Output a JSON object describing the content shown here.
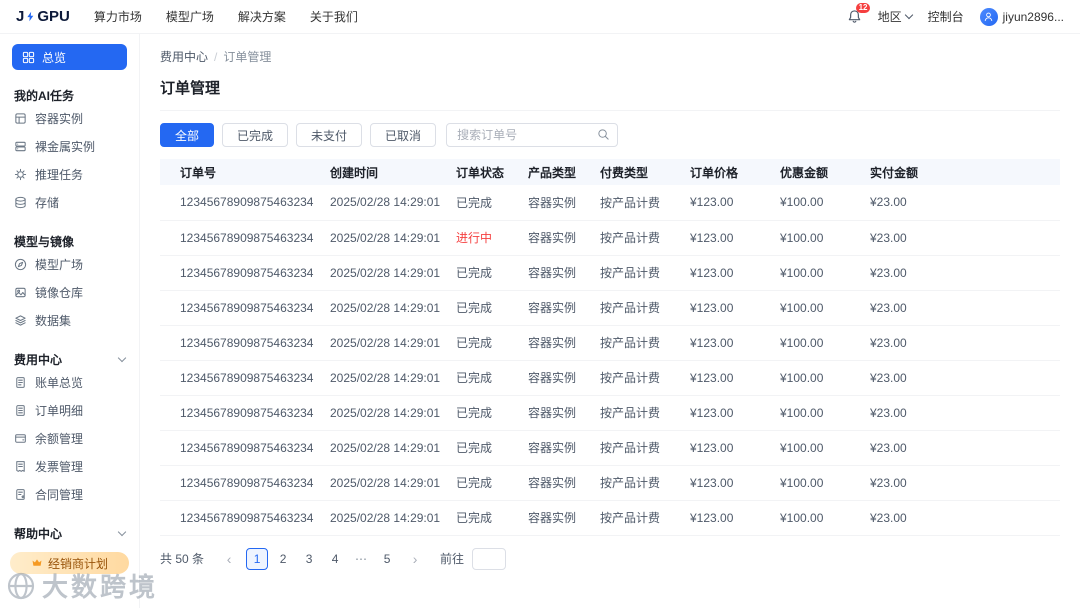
{
  "colors": {
    "primary": "#2468f2",
    "status_running": "#f53f3f",
    "status_done": "#4e5969",
    "badge_red": "#f53f3f",
    "dealer_text": "#99540a"
  },
  "navbar": {
    "logo_left": "J",
    "logo_right": "GPU",
    "items": [
      {
        "label": "算力市场"
      },
      {
        "label": "模型广场"
      },
      {
        "label": "解决方案"
      },
      {
        "label": "关于我们"
      }
    ],
    "notification_count": "12",
    "region_label": "地区",
    "console_label": "控制台",
    "username": "jiyun2896..."
  },
  "sidebar": {
    "overview_label": "总览",
    "sections": [
      {
        "title": "我的AI任务",
        "collapsible": false,
        "items": [
          {
            "label": "容器实例",
            "icon": "container-icon"
          },
          {
            "label": "裸金属实例",
            "icon": "baremetal-icon"
          },
          {
            "label": "推理任务",
            "icon": "inference-icon"
          },
          {
            "label": "存储",
            "icon": "storage-icon"
          }
        ]
      },
      {
        "title": "模型与镜像",
        "collapsible": false,
        "items": [
          {
            "label": "模型广场",
            "icon": "model-market-icon"
          },
          {
            "label": "镜像仓库",
            "icon": "image-repo-icon"
          },
          {
            "label": "数据集",
            "icon": "dataset-icon"
          }
        ]
      },
      {
        "title": "费用中心",
        "collapsible": true,
        "items": [
          {
            "label": "账单总览",
            "icon": "bill-icon"
          },
          {
            "label": "订单明细",
            "icon": "order-icon"
          },
          {
            "label": "余额管理",
            "icon": "balance-icon"
          },
          {
            "label": "发票管理",
            "icon": "invoice-icon"
          },
          {
            "label": "合同管理",
            "icon": "contract-icon"
          }
        ]
      },
      {
        "title": "帮助中心",
        "collapsible": true,
        "items": []
      }
    ],
    "dealer_label": "经销商计划"
  },
  "main": {
    "breadcrumb": {
      "parent": "费用中心",
      "separator": "/",
      "current": "订单管理"
    },
    "title": "订单管理",
    "filter_tabs": [
      {
        "label": "全部",
        "active": true
      },
      {
        "label": "已完成",
        "active": false
      },
      {
        "label": "未支付",
        "active": false
      },
      {
        "label": "已取消",
        "active": false
      }
    ],
    "search_placeholder": "搜索订单号",
    "table": {
      "headers": [
        "订单号",
        "创建时间",
        "订单状态",
        "产品类型",
        "付费类型",
        "订单价格",
        "优惠金额",
        "实付金额"
      ],
      "rows": [
        {
          "order_no": "12345678909875463234",
          "created": "2025/02/28 14:29:01",
          "status": "已完成",
          "state": "done",
          "product": "容器实例",
          "pay_type": "按产品计费",
          "price": "¥123.00",
          "discount": "¥100.00",
          "actual": "¥23.00"
        },
        {
          "order_no": "12345678909875463234",
          "created": "2025/02/28 14:29:01",
          "status": "进行中",
          "state": "running",
          "product": "容器实例",
          "pay_type": "按产品计费",
          "price": "¥123.00",
          "discount": "¥100.00",
          "actual": "¥23.00"
        },
        {
          "order_no": "12345678909875463234",
          "created": "2025/02/28 14:29:01",
          "status": "已完成",
          "state": "done",
          "product": "容器实例",
          "pay_type": "按产品计费",
          "price": "¥123.00",
          "discount": "¥100.00",
          "actual": "¥23.00"
        },
        {
          "order_no": "12345678909875463234",
          "created": "2025/02/28 14:29:01",
          "status": "已完成",
          "state": "done",
          "product": "容器实例",
          "pay_type": "按产品计费",
          "price": "¥123.00",
          "discount": "¥100.00",
          "actual": "¥23.00"
        },
        {
          "order_no": "12345678909875463234",
          "created": "2025/02/28 14:29:01",
          "status": "已完成",
          "state": "done",
          "product": "容器实例",
          "pay_type": "按产品计费",
          "price": "¥123.00",
          "discount": "¥100.00",
          "actual": "¥23.00"
        },
        {
          "order_no": "12345678909875463234",
          "created": "2025/02/28 14:29:01",
          "status": "已完成",
          "state": "done",
          "product": "容器实例",
          "pay_type": "按产品计费",
          "price": "¥123.00",
          "discount": "¥100.00",
          "actual": "¥23.00"
        },
        {
          "order_no": "12345678909875463234",
          "created": "2025/02/28 14:29:01",
          "status": "已完成",
          "state": "done",
          "product": "容器实例",
          "pay_type": "按产品计费",
          "price": "¥123.00",
          "discount": "¥100.00",
          "actual": "¥23.00"
        },
        {
          "order_no": "12345678909875463234",
          "created": "2025/02/28 14:29:01",
          "status": "已完成",
          "state": "done",
          "product": "容器实例",
          "pay_type": "按产品计费",
          "price": "¥123.00",
          "discount": "¥100.00",
          "actual": "¥23.00"
        },
        {
          "order_no": "12345678909875463234",
          "created": "2025/02/28 14:29:01",
          "status": "已完成",
          "state": "done",
          "product": "容器实例",
          "pay_type": "按产品计费",
          "price": "¥123.00",
          "discount": "¥100.00",
          "actual": "¥23.00"
        },
        {
          "order_no": "12345678909875463234",
          "created": "2025/02/28 14:29:01",
          "status": "已完成",
          "state": "done",
          "product": "容器实例",
          "pay_type": "按产品计费",
          "price": "¥123.00",
          "discount": "¥100.00",
          "actual": "¥23.00"
        }
      ]
    },
    "pagination": {
      "total_label": "共 50 条",
      "prev": "‹",
      "pages": [
        "1",
        "2",
        "3",
        "4",
        "⋯",
        "5"
      ],
      "active_page": "1",
      "next": "›",
      "goto_label": "前往",
      "goto_value": ""
    }
  },
  "watermark": {
    "text": "大数跨境"
  }
}
